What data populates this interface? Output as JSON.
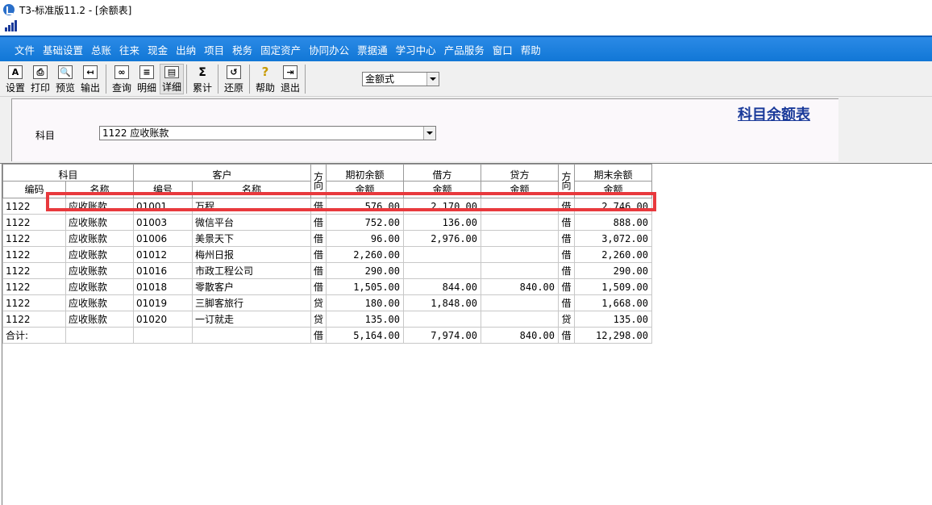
{
  "window": {
    "title": "T3-标准版11.2 - [余额表]"
  },
  "menubar": [
    "文件",
    "基础设置",
    "总账",
    "往来",
    "现金",
    "出纳",
    "项目",
    "税务",
    "固定资产",
    "协同办公",
    "票据通",
    "学习中心",
    "产品服务",
    "窗口",
    "帮助"
  ],
  "toolbar": {
    "buttons": [
      {
        "label": "设置",
        "icon": "setup-icon"
      },
      {
        "label": "打印",
        "icon": "printer-icon"
      },
      {
        "label": "预览",
        "icon": "preview-icon"
      },
      {
        "label": "输出",
        "icon": "export-icon"
      },
      {
        "label": "查询",
        "icon": "binoculars-icon"
      },
      {
        "label": "明细",
        "icon": "ledger-icon"
      },
      {
        "label": "详细",
        "icon": "detail-icon"
      },
      {
        "label": "累计",
        "icon": "sigma-icon"
      },
      {
        "label": "还原",
        "icon": "restore-icon"
      },
      {
        "label": "帮助",
        "icon": "help-icon"
      },
      {
        "label": "退出",
        "icon": "exit-icon"
      }
    ],
    "format_select": "金额式"
  },
  "header": {
    "report_title": "科目余额表",
    "subject_label": "科目",
    "subject_value": "1122 应收账款"
  },
  "table": {
    "group_headers": {
      "subject": "科目",
      "customer": "客户",
      "direction": "方向",
      "opening": "期初余额",
      "debit": "借方",
      "credit": "贷方",
      "direction2": "方向",
      "closing": "期末余额"
    },
    "sub_headers": {
      "code": "编码",
      "name": "名称",
      "cust_code": "编号",
      "cust_name": "名称",
      "amount1": "金额",
      "amount2": "金额",
      "amount3": "金额",
      "amount4": "金额"
    },
    "rows": [
      {
        "code": "1122",
        "name": "应收账款",
        "cust_code": "01001",
        "cust_name": "万程",
        "dir": "借",
        "opening": "576.00",
        "debit": "2,170.00",
        "credit": "",
        "dir2": "借",
        "closing": "2,746.00"
      },
      {
        "code": "1122",
        "name": "应收账款",
        "cust_code": "01003",
        "cust_name": "微信平台",
        "dir": "借",
        "opening": "752.00",
        "debit": "136.00",
        "credit": "",
        "dir2": "借",
        "closing": "888.00"
      },
      {
        "code": "1122",
        "name": "应收账款",
        "cust_code": "01006",
        "cust_name": "美景天下",
        "dir": "借",
        "opening": "96.00",
        "debit": "2,976.00",
        "credit": "",
        "dir2": "借",
        "closing": "3,072.00"
      },
      {
        "code": "1122",
        "name": "应收账款",
        "cust_code": "01012",
        "cust_name": "梅州日报",
        "dir": "借",
        "opening": "2,260.00",
        "debit": "",
        "credit": "",
        "dir2": "借",
        "closing": "2,260.00"
      },
      {
        "code": "1122",
        "name": "应收账款",
        "cust_code": "01016",
        "cust_name": "市政工程公司",
        "dir": "借",
        "opening": "290.00",
        "debit": "",
        "credit": "",
        "dir2": "借",
        "closing": "290.00"
      },
      {
        "code": "1122",
        "name": "应收账款",
        "cust_code": "01018",
        "cust_name": "零散客户",
        "dir": "借",
        "opening": "1,505.00",
        "debit": "844.00",
        "credit": "840.00",
        "dir2": "借",
        "closing": "1,509.00"
      },
      {
        "code": "1122",
        "name": "应收账款",
        "cust_code": "01019",
        "cust_name": "三脚客旅行",
        "dir": "贷",
        "opening": "180.00",
        "debit": "1,848.00",
        "credit": "",
        "dir2": "借",
        "closing": "1,668.00"
      },
      {
        "code": "1122",
        "name": "应收账款",
        "cust_code": "01020",
        "cust_name": "一订就走",
        "dir": "贷",
        "opening": "135.00",
        "debit": "",
        "credit": "",
        "dir2": "贷",
        "closing": "135.00"
      }
    ],
    "total": {
      "label": "合计:",
      "dir": "借",
      "opening": "5,164.00",
      "debit": "7,974.00",
      "credit": "840.00",
      "dir2": "借",
      "closing": "12,298.00"
    }
  },
  "colors": {
    "menubar": "#1177d6",
    "highlight": "#e8393d",
    "title_link": "#1a3a9a"
  }
}
